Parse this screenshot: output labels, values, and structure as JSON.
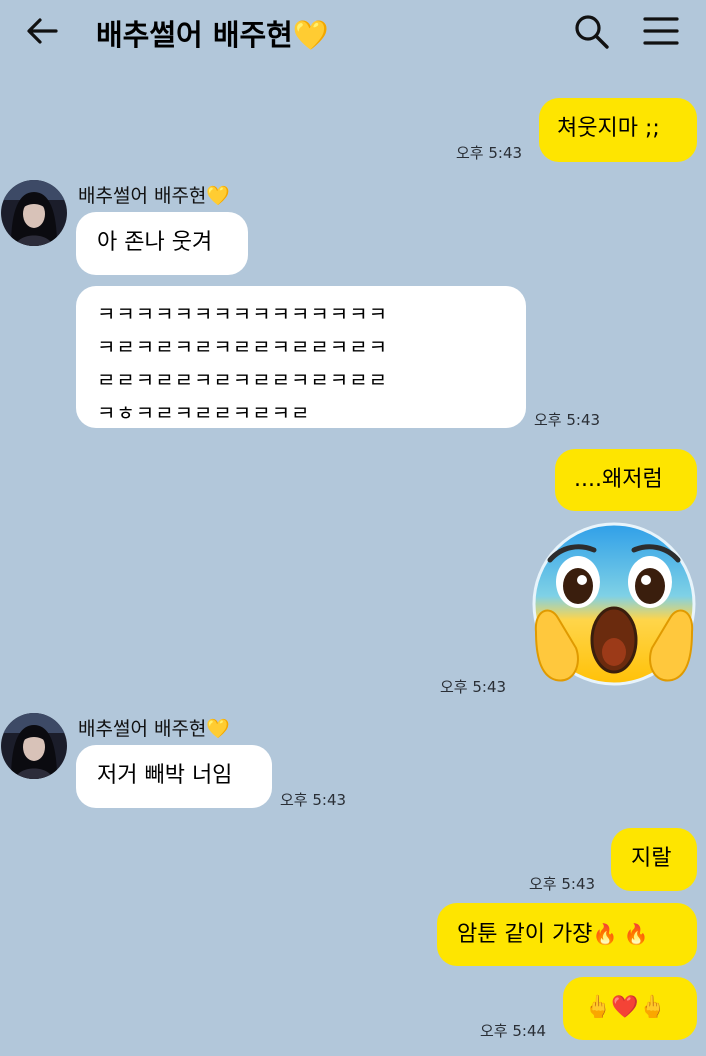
{
  "header": {
    "title": "배추썰어 배주현",
    "title_heart": "💛"
  },
  "colors": {
    "background": "#b2c7da",
    "my_bubble": "#fee500",
    "their_bubble": "#ffffff",
    "heart": "#f8b400"
  },
  "messages": {
    "m1": {
      "text": "쳐웃지마 ;;",
      "time": "오후 5:43"
    },
    "sender1": {
      "name": "배추썰어 배주현",
      "heart": "💛"
    },
    "m2": {
      "text": "아 존나 웃겨"
    },
    "m3": {
      "text": "ㅋㅋㅋㅋㅋㅋㅋㅋㅋㅋㅋㅋㅋㅋㅋ\nㅋㄹㅋㄹㅋㄹㅋㄹㄹㅋㄹㄹㅋㄹㅋ\nㄹㄹㅋㄹㄹㅋㄹㅋㄹㄹㅋㄹㅋㄹㄹ\nㅋㅎㅋㄹㅋㄹㄹㅋㄹㅋㄹ",
      "time": "오후 5:43"
    },
    "m4": {
      "text": "....왜저럼"
    },
    "m5": {
      "emoji": "scream-emoji",
      "time": "오후 5:43"
    },
    "sender2": {
      "name": "배추썰어 배주현",
      "heart": "💛"
    },
    "m6": {
      "text": "저거 빼박 너임",
      "time": "오후 5:43"
    },
    "m7": {
      "text": "지랄",
      "time": "오후 5:43"
    },
    "m8": {
      "text": "암툰 같이 가쟝",
      "emoji": "🔥 🔥"
    },
    "m9": {
      "emoji": "🖕❤️🖕",
      "time": "오후 5:44"
    }
  }
}
